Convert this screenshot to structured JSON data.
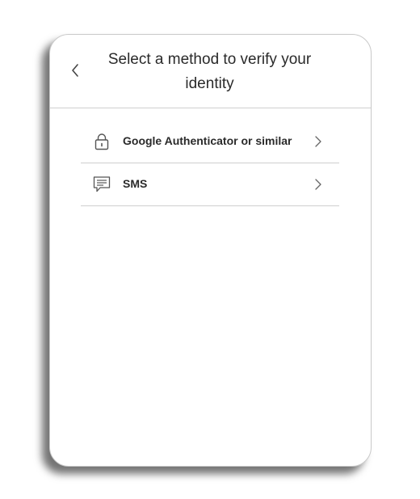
{
  "header": {
    "title": "Select a method to verify your identity",
    "back_icon": "chevron-left-icon"
  },
  "methods": [
    {
      "label": "Google Authenticator or similar",
      "icon": "lock-icon"
    },
    {
      "label": "SMS",
      "icon": "message-icon"
    }
  ],
  "colors": {
    "text": "#2a2a2a",
    "divider": "#cfcfcf",
    "icon": "#555555"
  }
}
